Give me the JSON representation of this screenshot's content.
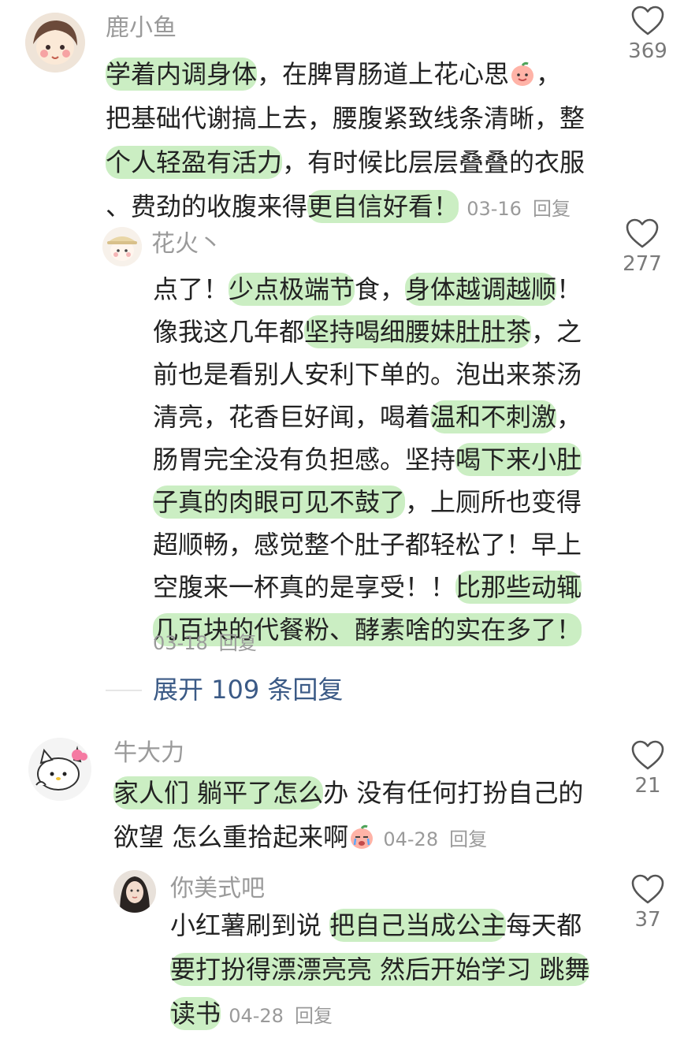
{
  "colors": {
    "highlight": "#cbeec3",
    "name": "#9a9a9a",
    "expand": "#3b5a86",
    "text": "#222222"
  },
  "comments": [
    {
      "author": "鹿小鱼",
      "likes": "369",
      "avatar_icon": "cartoon-girl-avatar",
      "lines": [
        [
          "学着内调身体",
          "，在脾胃肠道上花心思"
        ],
        [
          "把基础代谢搞上去，腰腹紧致线条清晰，整"
        ],
        [
          "个人轻盈有活力",
          "，有时候比层层叠叠的衣服"
        ],
        [
          "、费劲的收腹来得",
          "更自信好看！"
        ]
      ],
      "line1_tail": "，",
      "date": "03-16",
      "reply_label": "回复",
      "reply": {
        "author": "花火丶",
        "likes": "277",
        "avatar_icon": "hat-cartoon-avatar",
        "seg": [
          "点了！",
          "少点极端节",
          "食，",
          "身体越调越顺",
          "！",
          "像我这几年都",
          "坚持喝细腰妹肚肚茶",
          "，之",
          "前也是看别人安利下单的。泡出来茶汤",
          "清亮，花香巨好闻，喝着",
          "温和不刺激",
          "，",
          "肠胃完全没有负担感。坚持",
          "喝下来小肚",
          "子真的肉眼可见不鼓了",
          "，上厕所也变得",
          "超顺畅，感觉整个肚子都轻松了！早上",
          "空腹来一杯真的是享受！！",
          "比那些动辄",
          "几百块的代餐粉、酵素啥的实在多了！"
        ],
        "date": "03-18",
        "reply_label": "回复"
      },
      "expand_label": "展开 109 条回复"
    },
    {
      "author": "牛大力",
      "likes": "21",
      "avatar_icon": "hello-kitty-avatar",
      "seg": [
        "家人们 躺平了怎么",
        "办 没有任何打扮自己的",
        "欲望 怎么重拾起来啊"
      ],
      "date": "04-28",
      "reply_label": "回复",
      "reply": {
        "author": "你美式吧",
        "likes": "37",
        "avatar_icon": "girl-photo-avatar",
        "seg": [
          "小红薯刷到说 ",
          "把自己当成公主",
          "每天都",
          "要打扮得漂漂亮亮 然后开始学习 跳舞",
          "读书"
        ],
        "date": "04-28",
        "reply_label": "回复"
      }
    }
  ]
}
